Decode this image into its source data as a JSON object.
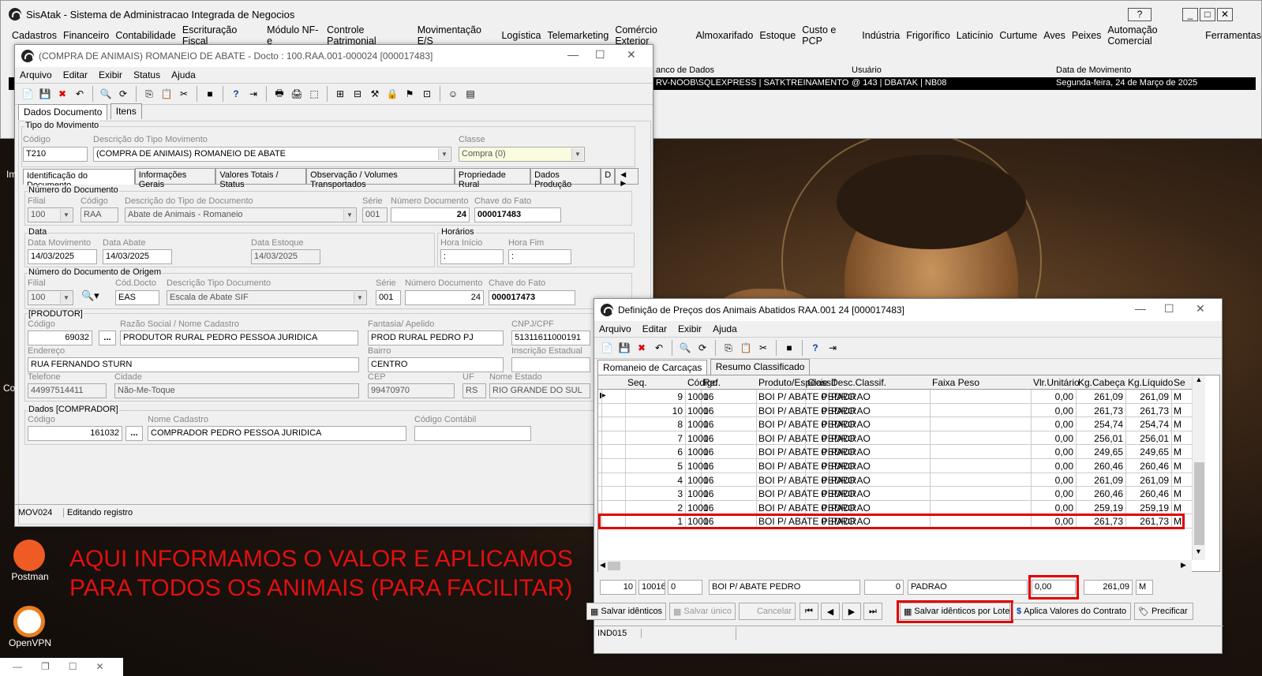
{
  "main": {
    "title": "SisAtak - Sistema de Administracao Integrada de Negocios",
    "help_btn": "?",
    "menu": [
      "Cadastros",
      "Financeiro",
      "Contabilidade",
      "Escrituração Fiscal",
      "Módulo NF-e",
      "Controle Patrimonial",
      "Movimentação E/S",
      "Logística",
      "Telemarketing",
      "Comércio Exterior",
      "Almoxarifado",
      "Estoque",
      "Custo e PCP",
      "Indústria",
      "Frigorífico",
      "Laticínio",
      "Curtume",
      "Aves",
      "Peixes",
      "Automação Comercial",
      "Ferramentas"
    ],
    "info_headers": {
      "db": "anco de Dados",
      "user": "Usuário",
      "date": "Data de Movimento"
    },
    "info_values": {
      "db": "RV-NOOB\\SQLEXPRESS | SATKTREINAMENTO",
      "user": "@ 143 | DBATAK | NB08",
      "date": "Segunda-feira, 24 de Março de 2025"
    }
  },
  "romaneio": {
    "title": "(COMPRA DE ANIMAIS) ROMANEIO DE ABATE - Docto : 100.RAA.001-000024 [000017483]",
    "menu": [
      "Arquivo",
      "Editar",
      "Exibir",
      "Status",
      "Ajuda"
    ],
    "tabs": [
      "Dados Documento",
      "Itens"
    ],
    "tipo": {
      "group": "Tipo do Movimento",
      "codigo_label": "Código",
      "codigo": "T210",
      "desc_label": "Descrição do Tipo Movimento",
      "desc": "(COMPRA DE ANIMAIS) ROMANEIO DE ABATE",
      "classe_label": "Classe",
      "classe": "Compra (0)"
    },
    "subtabs": [
      "Identificação do Documento",
      "Informações Gerais",
      "Valores Totais / Status",
      "Observação / Volumes Transportados",
      "Propriedade Rural",
      "Dados Produção",
      "D"
    ],
    "numdoc": {
      "group": "Número do Documento",
      "filial_label": "Filial",
      "filial": "100",
      "codigo_label": "Código",
      "codigo": "RAA",
      "desc_label": "Descrição do Tipo de Documento",
      "desc": "Abate de Animais - Romaneio",
      "serie_label": "Série",
      "serie": "001",
      "num_label": "Número Documento",
      "num": "24",
      "chave_label": "Chave do Fato",
      "chave": "000017483"
    },
    "data": {
      "group": "Data",
      "mov_label": "Data Movimento",
      "mov": "14/03/2025",
      "abate_label": "Data Abate",
      "abate": "14/03/2025",
      "estoque_label": "Data Estoque",
      "estoque": "14/03/2025"
    },
    "horarios": {
      "group": "Horários",
      "ini_label": "Hora Início",
      "ini": ":",
      "fim_label": "Hora Fim",
      "fim": ":"
    },
    "origem": {
      "group": "Número do Documento de Origem",
      "filial_label": "Filial",
      "filial": "100",
      "cod_label": "Cód.Docto",
      "cod": "EAS",
      "desc_label": "Descrição Tipo Documento",
      "desc": "Escala de Abate SIF",
      "serie_label": "Série",
      "serie": "001",
      "num_label": "Número Documento",
      "num": "24",
      "chave_label": "Chave do Fato",
      "chave": "000017473"
    },
    "produtor": {
      "group": "[PRODUTOR]",
      "codigo_label": "Código",
      "codigo": "69032",
      "razao_label": "Razão Social / Nome Cadastro",
      "razao": "PRODUTOR RURAL PEDRO PESSOA JURIDICA",
      "fantasia_label": "Fantasia/ Apelido",
      "fantasia": "PROD RURAL PEDRO PJ",
      "cnpj_label": "CNPJ/CPF",
      "cnpj": "51311611000191",
      "end_label": "Endereço",
      "end": "RUA FERNANDO STURN",
      "bairro_label": "Bairro",
      "bairro": "CENTRO",
      "ie_label": "Inscrição Estadual",
      "tel_label": "Telefone",
      "tel": "44997514411",
      "cidade_label": "Cidade",
      "cidade": "Não-Me-Toque",
      "cep_label": "CEP",
      "cep": "99470970",
      "uf_label": "UF",
      "uf": "RS",
      "estado_label": "Nome Estado",
      "estado": "RIO GRANDE DO SUL"
    },
    "comprador": {
      "group": "Dados [COMPRADOR]",
      "codigo_label": "Código",
      "codigo": "161032",
      "nome_label": "Nome Cadastro",
      "nome": "COMPRADOR PEDRO PESSOA JURIDICA",
      "contabil_label": "Código Contábil"
    },
    "status": [
      "MOV024",
      "Editando registro"
    ]
  },
  "precos": {
    "title": "Definição de Preços dos Animais Abatidos  RAA.001 24 [000017483]",
    "menu": [
      "Arquivo",
      "Editar",
      "Exibir",
      "Ajuda"
    ],
    "tabs": [
      "Romaneio de Carcaças",
      "Resumo Classificado"
    ],
    "columns": [
      "Seq.",
      "Código",
      "Ref.",
      "Produto/Espécie",
      "Classif",
      "Desc.Classif.",
      "Faixa Peso",
      "Vlr.Unitário",
      "Kg.Cabeça",
      "Kg.Líquido",
      "Se"
    ],
    "rows": [
      [
        "9",
        "10016",
        "0",
        "BOI P/ ABATE PEDRO",
        "0",
        "PADRAO",
        "",
        "0,00",
        "261,09",
        "261,09",
        "M"
      ],
      [
        "10",
        "10016",
        "0",
        "BOI P/ ABATE PEDRO",
        "0",
        "PADRAO",
        "",
        "0,00",
        "261,73",
        "261,73",
        "M"
      ],
      [
        "8",
        "10016",
        "0",
        "BOI P/ ABATE PEDRO",
        "0",
        "PADRAO",
        "",
        "0,00",
        "254,74",
        "254,74",
        "M"
      ],
      [
        "7",
        "10016",
        "0",
        "BOI P/ ABATE PEDRO",
        "0",
        "PADRAO",
        "",
        "0,00",
        "256,01",
        "256,01",
        "M"
      ],
      [
        "6",
        "10016",
        "0",
        "BOI P/ ABATE PEDRO",
        "0",
        "PADRAO",
        "",
        "0,00",
        "249,65",
        "249,65",
        "M"
      ],
      [
        "5",
        "10016",
        "0",
        "BOI P/ ABATE PEDRO",
        "0",
        "PADRAO",
        "",
        "0,00",
        "260,46",
        "260,46",
        "M"
      ],
      [
        "4",
        "10016",
        "0",
        "BOI P/ ABATE PEDRO",
        "0",
        "PADRAO",
        "",
        "0,00",
        "261,09",
        "261,09",
        "M"
      ],
      [
        "3",
        "10016",
        "0",
        "BOI P/ ABATE PEDRO",
        "0",
        "PADRAO",
        "",
        "0,00",
        "260,46",
        "260,46",
        "M"
      ],
      [
        "2",
        "10016",
        "0",
        "BOI P/ ABATE PEDRO",
        "0",
        "PADRAO",
        "",
        "0,00",
        "259,19",
        "259,19",
        "M"
      ],
      [
        "1",
        "10016",
        "0",
        "BOI P/ ABATE PEDRO",
        "0",
        "PADRAO",
        "",
        "0,00",
        "261,73",
        "261,73",
        "M"
      ]
    ],
    "edit": {
      "seq": "10",
      "codigo": "10016",
      "ref": "0",
      "produto": "BOI P/ ABATE PEDRO",
      "classif": "0",
      "desc": "PADRAO",
      "vlr": "0,00",
      "kg": "261,09",
      "se": "M"
    },
    "buttons": {
      "salvar_identicos": "Salvar idênticos",
      "salvar_unico": "Salvar único",
      "cancelar": "Cancelar",
      "salvar_lote": "Salvar idênticos por Lote",
      "aplica": "Aplica Valores do Contrato",
      "precificar": "Precificar"
    },
    "status": "IND015"
  },
  "annotation": [
    "AQUI INFORMAMOS O VALOR E APLICAMOS",
    "PARA TODOS OS ANIMAIS (PARA FACILITAR)"
  ],
  "desktop": {
    "postman": "Postman",
    "openvpn": "OpenVPN",
    "im": "Im",
    "co": "Co"
  },
  "colors": {
    "highlight": "#e00000",
    "annotation": "#e01010"
  }
}
